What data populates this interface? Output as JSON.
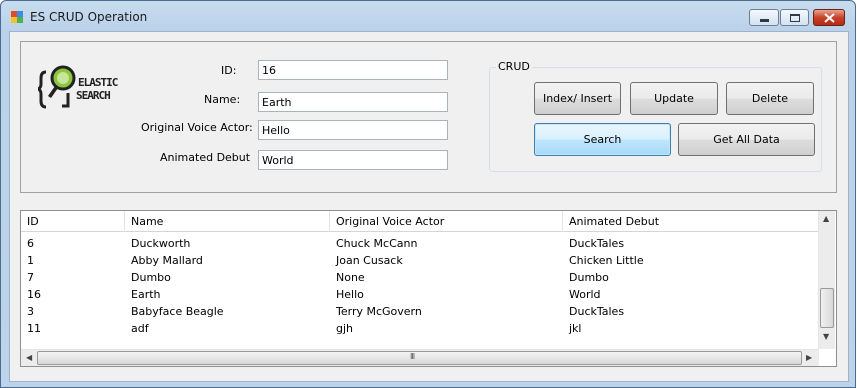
{
  "window": {
    "title": "ES CRUD Operation"
  },
  "form": {
    "id_label": "ID:",
    "id_value": "16",
    "name_label": "Name:",
    "name_value": "Earth",
    "voice_label": "Original Voice Actor:",
    "voice_value": "Hello",
    "debut_label": "Animated Debut",
    "debut_value": "World"
  },
  "logo": {
    "text_line1": "ELASTIC",
    "text_line2": "SEARCH",
    "icon": "magnifier-icon"
  },
  "crud": {
    "group_title": "CRUD",
    "index_insert_label": "Index/ Insert",
    "update_label": "Update",
    "delete_label": "Delete",
    "search_label": "Search",
    "get_all_label": "Get All Data"
  },
  "grid": {
    "columns": [
      "ID",
      "Name",
      "Original Voice Actor",
      "Animated Debut"
    ],
    "rows": [
      [
        "6",
        "Duckworth",
        "Chuck McCann",
        "DuckTales"
      ],
      [
        "1",
        "Abby Mallard",
        "Joan Cusack",
        "Chicken Little"
      ],
      [
        "7",
        "Dumbo",
        "None",
        "Dumbo"
      ],
      [
        "16",
        "Earth",
        "Hello",
        "World"
      ],
      [
        "3",
        "Babyface Beagle",
        "Terry McGovern",
        "DuckTales"
      ],
      [
        "11",
        "adf",
        "gjh",
        "jkl"
      ]
    ],
    "hscroll_grip": "III"
  },
  "colors": {
    "titlebar": "#bcd3eb",
    "close_button": "#c7432a",
    "focused_button": "#3c7fb1"
  }
}
